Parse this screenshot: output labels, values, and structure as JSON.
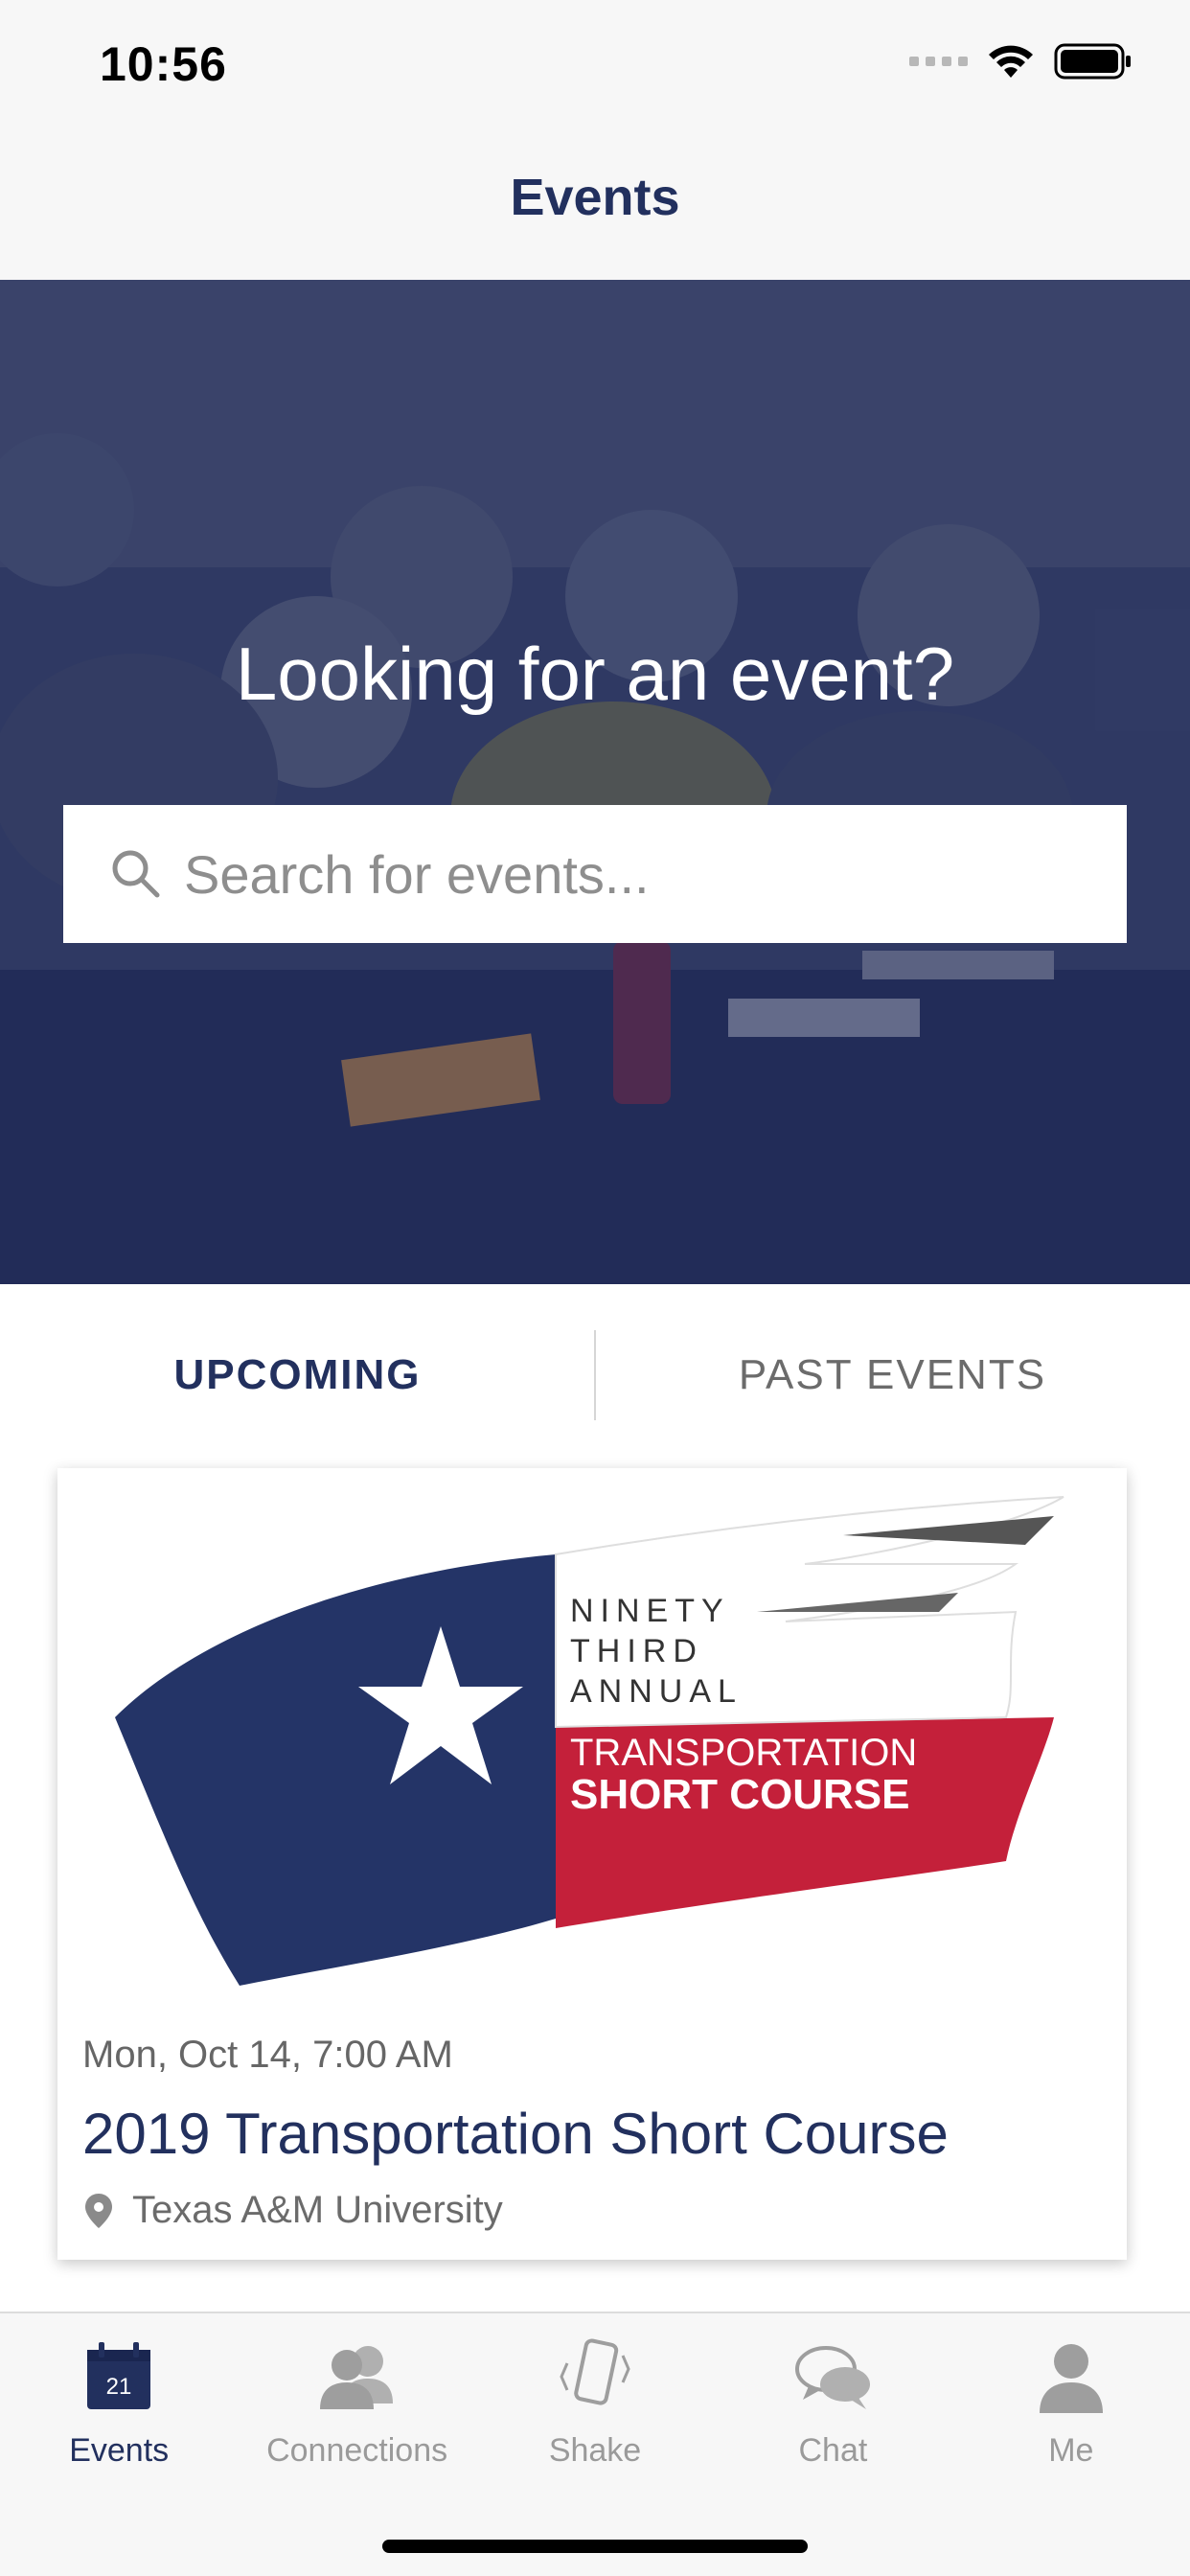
{
  "status_bar": {
    "time": "10:56"
  },
  "nav": {
    "title": "Events"
  },
  "hero": {
    "title": "Looking for an event?",
    "search_placeholder": "Search for events..."
  },
  "tabs": [
    {
      "label": "UPCOMING",
      "active": true
    },
    {
      "label": "PAST EVENTS",
      "active": false
    }
  ],
  "event": {
    "banner": {
      "line1": "NINETY",
      "line2": "THIRD",
      "line3": "ANNUAL",
      "line4": "TRANSPORTATION",
      "line5": "SHORT COURSE"
    },
    "date": "Mon, Oct 14, 7:00 AM",
    "title": "2019 Transportation Short Course",
    "location": "Texas A&M University"
  },
  "tab_bar": {
    "items": [
      {
        "label": "Events",
        "icon": "calendar-icon",
        "badge": "21",
        "active": true
      },
      {
        "label": "Connections",
        "icon": "people-icon",
        "active": false
      },
      {
        "label": "Shake",
        "icon": "phone-shake-icon",
        "active": false
      },
      {
        "label": "Chat",
        "icon": "chat-icon",
        "active": false
      },
      {
        "label": "Me",
        "icon": "person-icon",
        "active": false
      }
    ]
  },
  "colors": {
    "brand_navy": "#22305e",
    "brand_red": "#c4203a",
    "inactive": "#9a9a9a"
  }
}
